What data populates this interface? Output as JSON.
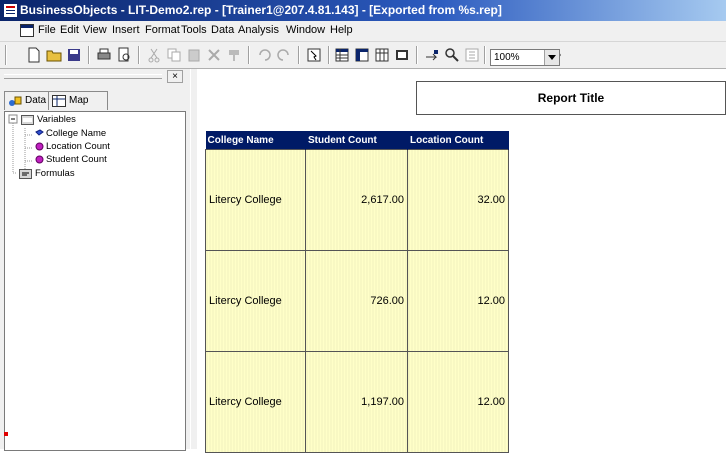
{
  "window": {
    "title": "BusinessObjects - LIT-Demo2.rep - [Trainer1@207.4.81.143] - [Exported from %s.rep]"
  },
  "menu": [
    "File",
    "Edit",
    "View",
    "Insert",
    "Format",
    "Tools",
    "Data",
    "Analysis",
    "Window",
    "Help"
  ],
  "toolbar": {
    "zoom": "100%",
    "buttons": [
      "new-icon",
      "open-icon",
      "save-icon",
      "print-icon",
      "print-preview-icon",
      "cut-icon",
      "copy-icon",
      "paste-icon",
      "delete-icon",
      "format-painter-icon",
      "undo-icon",
      "redo-icon",
      "select-icon",
      "table-icon",
      "crosstab-icon",
      "chart-icon",
      "structure-icon",
      "drill-icon",
      "find-icon",
      "slice-icon",
      "help-icon"
    ]
  },
  "panel": {
    "tabs": [
      "Data",
      "Map"
    ],
    "tree": {
      "variables_label": "Variables",
      "items": [
        "College Name",
        "Location Count",
        "Student Count"
      ],
      "formulas_label": "Formulas"
    }
  },
  "report": {
    "title": "Report Title",
    "columns": [
      "College Name",
      "Student Count",
      "Location Count"
    ],
    "rows": [
      [
        "Litercy College",
        "2,617.00",
        "32.00"
      ],
      [
        "Litercy College",
        "726.00",
        "12.00"
      ],
      [
        "Litercy College",
        "1,197.00",
        "12.00"
      ]
    ]
  },
  "colors": {
    "header_bg": "#001a66",
    "cell_bg": "#ffffc8",
    "titlebar": "#0a246a"
  }
}
